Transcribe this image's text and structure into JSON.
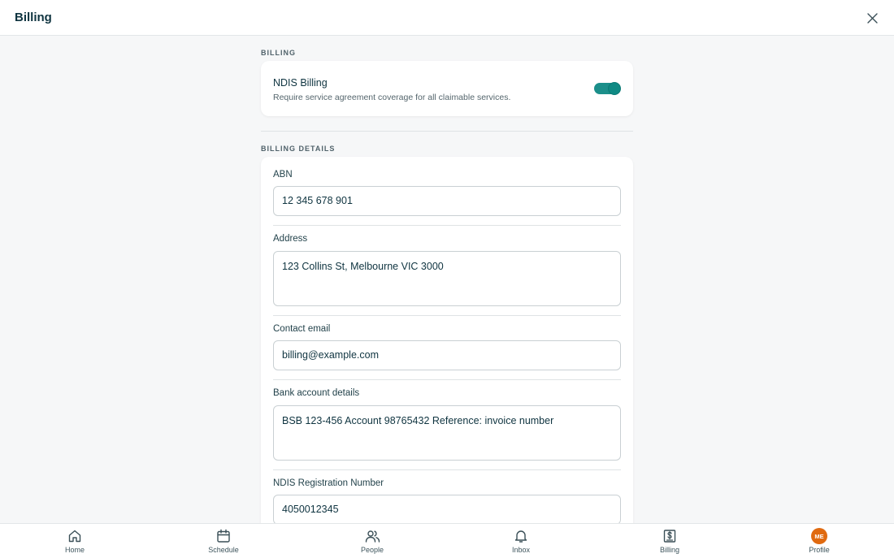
{
  "header": {
    "title": "Billing"
  },
  "billing_section": {
    "label": "BILLING",
    "ndis": {
      "title": "NDIS Billing",
      "description": "Require service agreement coverage for all claimable services.",
      "enabled": true
    }
  },
  "details_section": {
    "label": "BILLING DETAILS",
    "fields": [
      {
        "label": "ABN",
        "value": "12 345 678 901"
      },
      {
        "label": "Address",
        "value": "123 Collins St, Melbourne VIC 3000"
      },
      {
        "label": "Contact email",
        "value": "billing@example.com"
      },
      {
        "label": "Bank account details",
        "value": "BSB 123-456  Account 98765432  Reference: invoice number"
      },
      {
        "label": "NDIS Registration Number",
        "value": "4050012345"
      }
    ]
  },
  "nav": {
    "items": [
      {
        "label": "Home",
        "icon": "home-icon"
      },
      {
        "label": "Schedule",
        "icon": "calendar-icon"
      },
      {
        "label": "People",
        "icon": "people-icon"
      },
      {
        "label": "Inbox",
        "icon": "bell-icon"
      },
      {
        "label": "Billing",
        "icon": "dollar-receipt-icon"
      },
      {
        "label": "Profile",
        "icon": "avatar",
        "initials": "ME"
      }
    ]
  },
  "colors": {
    "accent": "#1b8f8a",
    "avatar": "#e06a10",
    "text": "#0f3440"
  }
}
